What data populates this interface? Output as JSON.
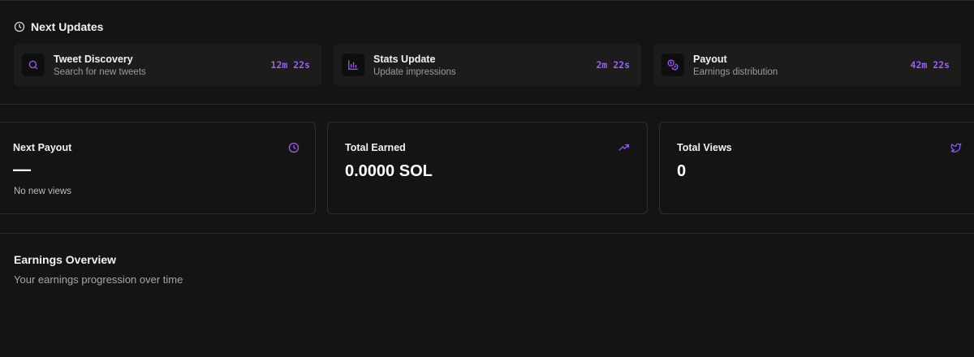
{
  "next_updates": {
    "title": "Next Updates",
    "items": [
      {
        "name": "Tweet Discovery",
        "description": "Search for new tweets",
        "timer": "12m 22s",
        "icon": "search-icon"
      },
      {
        "name": "Stats Update",
        "description": "Update impressions",
        "timer": "2m 22s",
        "icon": "bar-chart-icon"
      },
      {
        "name": "Payout",
        "description": "Earnings distribution",
        "timer": "42m 22s",
        "icon": "coins-icon"
      }
    ]
  },
  "stats": {
    "next_payout": {
      "label": "Next Payout",
      "value": "—",
      "sub": "No new views",
      "icon": "clock-icon"
    },
    "total_earned": {
      "label": "Total Earned",
      "value": "0.0000 SOL",
      "icon": "trending-up-icon"
    },
    "total_views": {
      "label": "Total Views",
      "value": "0",
      "icon": "twitter-icon"
    }
  },
  "earnings_overview": {
    "title": "Earnings Overview",
    "subtitle": "Your earnings progression over time"
  },
  "colors": {
    "background": "#141414",
    "card": "#1c1c1c",
    "accent": "#9d5ff0",
    "border": "#2e2e2e"
  }
}
